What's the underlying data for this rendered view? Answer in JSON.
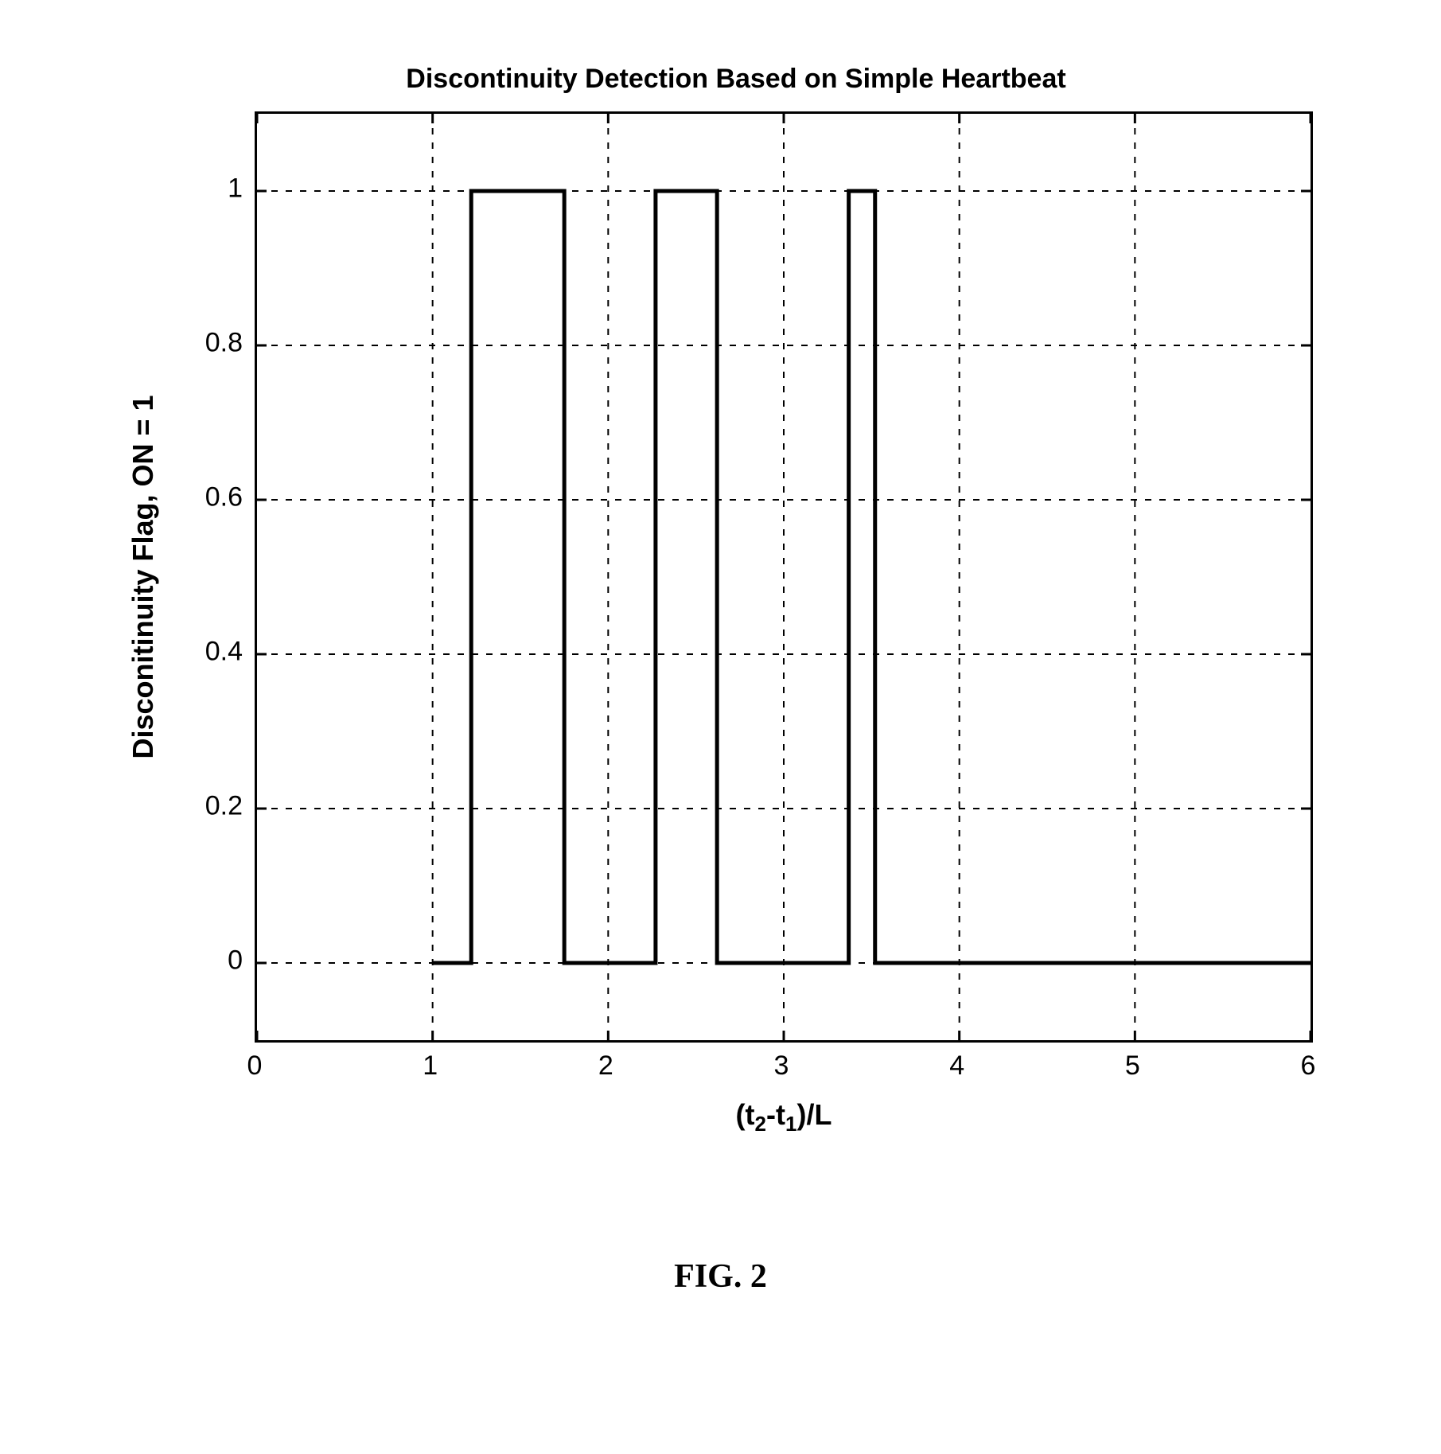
{
  "chart_data": {
    "type": "line",
    "title": "Discontinuity Detection Based on Simple Heartbeat",
    "xlabel": "(t₂-t₁)/L",
    "ylabel": "Disconitinuity Flag, ON = 1",
    "xlim": [
      0,
      6
    ],
    "ylim": [
      -0.1,
      1.1
    ],
    "x_ticks": [
      0,
      1,
      2,
      3,
      4,
      5,
      6
    ],
    "y_ticks": [
      0,
      0.2,
      0.4,
      0.6,
      0.8,
      1
    ],
    "series": [
      {
        "name": "flag",
        "x": [
          1.0,
          1.22,
          1.22,
          1.75,
          1.75,
          2.27,
          2.27,
          2.62,
          2.62,
          3.37,
          3.37,
          3.52,
          3.52,
          6.0
        ],
        "y": [
          0,
          0,
          1,
          1,
          0,
          0,
          1,
          1,
          0,
          0,
          1,
          1,
          0,
          0
        ]
      }
    ]
  },
  "caption": "FIG. 2"
}
